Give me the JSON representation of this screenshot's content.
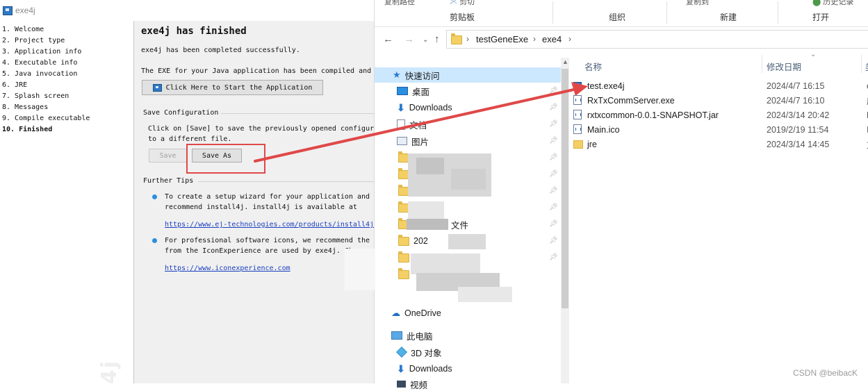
{
  "exe4j": {
    "window_title": "exe4j",
    "steps": [
      "1. Welcome",
      "2. Project type",
      "3. Application info",
      "4. Executable info",
      "5. Java invocation",
      "6. JRE",
      "7. Splash screen",
      "8. Messages",
      "9. Compile executable",
      "10. Finished"
    ],
    "active_step": 9,
    "logo_text": "4j",
    "heading": "exe4j has finished",
    "completed_text": "exe4j has been completed successfully.",
    "compiled_text": "The EXE for your Java application has been compiled and",
    "start_button": "Click Here to Start the Application",
    "save_config_title": "Save Configuration",
    "save_config_line1": "Click on [Save] to save the previously opened configur",
    "save_config_line2": "to a different file.",
    "save_button": "Save",
    "save_as_button": "Save As",
    "further_tips_title": "Further Tips",
    "tip1_line1": "To create a setup wizard for your application and",
    "tip1_line2": "recommend install4j. install4j is available at",
    "tip1_link": "https://www.ej-technologies.com/products/install4j",
    "tip2_line1": "For professional software icons, we recommend the I",
    "tip2_line2": "from the IconExperience are used by exe4j. Che",
    "tip2_link": "https://www.iconexperience.com"
  },
  "explorer": {
    "ribbon": {
      "groups": [
        "剪贴板",
        "组织",
        "新建",
        "打开"
      ],
      "partial_top": [
        "复制路径",
        "剪切",
        "复制到",
        "历史记录"
      ]
    },
    "breadcrumb": [
      "testGeneExe",
      "exe4"
    ],
    "nav_items": {
      "quick_access": "快速访问",
      "desktop": "桌面",
      "downloads": "Downloads",
      "documents": "文档",
      "pictures": "图片",
      "partial_1": "2024",
      "partial_2": "文件",
      "partial_3": "202",
      "onedrive": "OneDrive",
      "this_pc": "此电脑",
      "objects_3d": "3D 对象",
      "downloads2": "Downloads",
      "videos": "视频"
    },
    "columns": {
      "name": "名称",
      "date": "修改日期",
      "type": "类"
    },
    "files": [
      {
        "name": "test.exe4j",
        "date": "2024/4/7 16:15",
        "type": "e",
        "icon": "exe4j-icon"
      },
      {
        "name": "RxTxCommServer.exe",
        "date": "2024/4/7 16:10",
        "type": "应",
        "icon": "exe-icon"
      },
      {
        "name": "rxtxcommon-0.0.1-SNAPSHOT.jar",
        "date": "2024/3/14 20:42",
        "type": "E",
        "icon": "jar-icon"
      },
      {
        "name": "Main.ico",
        "date": "2019/2/19 11:54",
        "type": "I",
        "icon": "ico-icon"
      },
      {
        "name": "jre",
        "date": "2024/3/14 14:45",
        "type": "文",
        "icon": "folder-icon"
      }
    ]
  },
  "watermark": "CSDN @beibacK",
  "colors": {
    "highlight": "#e04848",
    "arrow": "#e04848",
    "selection": "#cce8ff",
    "link": "#1a3fbf"
  }
}
